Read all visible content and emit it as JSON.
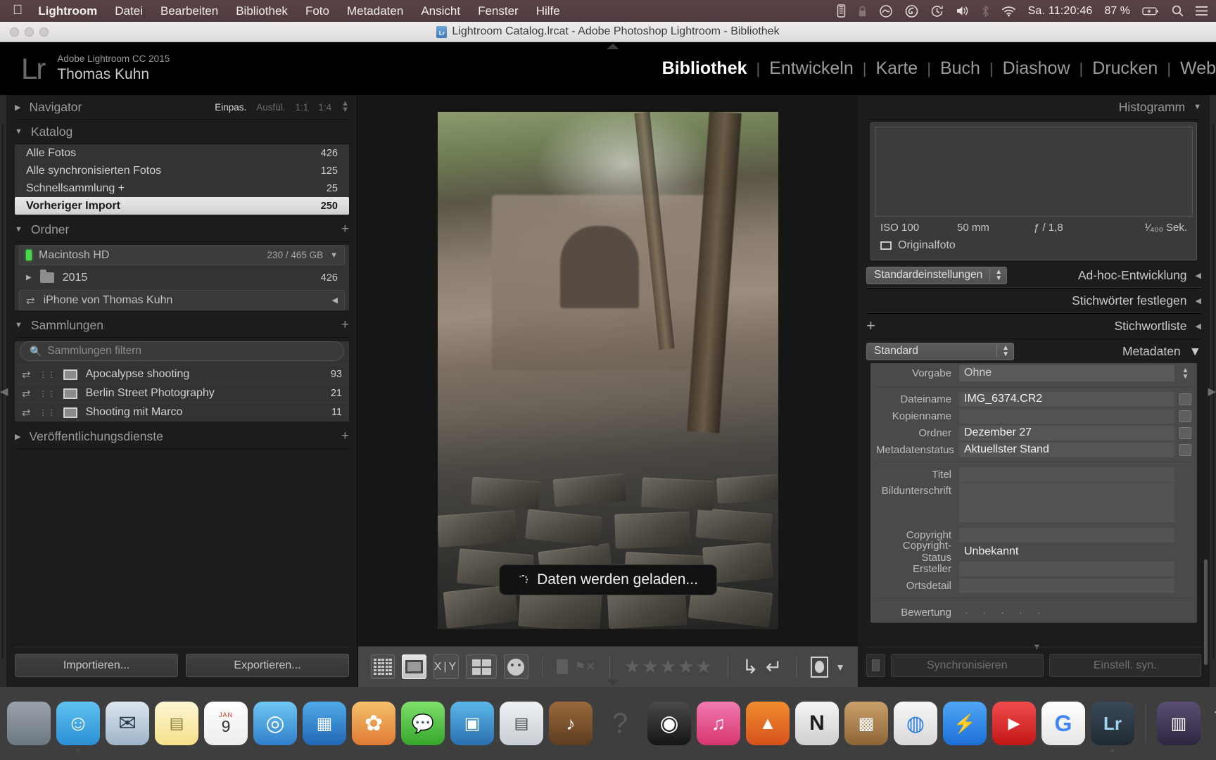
{
  "menubar": {
    "apple": "",
    "app_name": "Lightroom",
    "items": [
      "Datei",
      "Bearbeiten",
      "Bibliothek",
      "Foto",
      "Metadaten",
      "Ansicht",
      "Fenster",
      "Hilfe"
    ],
    "status_icons": [
      "battery-indicator-icon",
      "lock-icon",
      "creative-cloud-icon",
      "adobe-app-icon",
      "time-machine-icon",
      "volume-icon",
      "bluetooth-icon",
      "wifi-icon"
    ],
    "clock": "Sa. 11:20:46",
    "battery": "87 %",
    "right_icons": [
      "spotlight-search-icon",
      "notification-center-icon"
    ]
  },
  "titlebar": {
    "title": "Lightroom Catalog.lrcat - Adobe Photoshop Lightroom - Bibliothek"
  },
  "identity": {
    "logo": "Lr",
    "product": "Adobe Lightroom CC 2015",
    "user": "Thomas Kuhn"
  },
  "modules": [
    {
      "label": "Bibliothek",
      "active": true
    },
    {
      "label": "Entwickeln",
      "active": false
    },
    {
      "label": "Karte",
      "active": false
    },
    {
      "label": "Buch",
      "active": false
    },
    {
      "label": "Diashow",
      "active": false
    },
    {
      "label": "Drucken",
      "active": false
    },
    {
      "label": "Web",
      "active": false
    }
  ],
  "left_panel": {
    "navigator": {
      "title": "Navigator",
      "zoom_levels": [
        "Einpas.",
        "Ausfül.",
        "1:1",
        "1:4"
      ],
      "active_zoom": "Einpas."
    },
    "katalog": {
      "title": "Katalog",
      "items": [
        {
          "label": "Alle Fotos",
          "count": "426",
          "selected": false
        },
        {
          "label": "Alle synchronisierten Fotos",
          "count": "125",
          "selected": false
        },
        {
          "label": "Schnellsammlung  +",
          "count": "25",
          "selected": false
        },
        {
          "label": "Vorheriger Import",
          "count": "250",
          "selected": true
        }
      ]
    },
    "ordner": {
      "title": "Ordner",
      "volume": {
        "name": "Macintosh HD",
        "space": "230 / 465 GB"
      },
      "folders": [
        {
          "label": "2015",
          "count": "426"
        }
      ],
      "device": "iPhone von Thomas Kuhn"
    },
    "sammlungen": {
      "title": "Sammlungen",
      "filter_placeholder": "Sammlungen filtern",
      "items": [
        {
          "label": "Apocalypse shooting",
          "count": "93"
        },
        {
          "label": "Berlin Street Photography",
          "count": "21"
        },
        {
          "label": "Shooting mit Marco",
          "count": "11"
        }
      ]
    },
    "publish": {
      "title": "Veröffentlichungsdienste"
    },
    "buttons": {
      "import": "Importieren...",
      "export": "Exportieren..."
    }
  },
  "center": {
    "loading_text": "Daten werden geladen...",
    "toolbar": {
      "view_icons": [
        "grid-view-icon",
        "loupe-view-icon",
        "compare-view-icon",
        "survey-view-icon",
        "people-view-icon"
      ],
      "flag_icons": [
        "flag-pick-icon",
        "flag-reject-icon"
      ],
      "stars": "★★★★★",
      "rotate_icons": [
        "rotate-left-icon",
        "rotate-right-icon"
      ],
      "crop_icon": "crop-overlay-icon",
      "caret": "toolbar-caret-icon"
    }
  },
  "right_panel": {
    "histogram": {
      "title": "Histogramm",
      "iso": "ISO 100",
      "focal": "50 mm",
      "aperture": "ƒ / 1,8",
      "shutter": "¹⁄₄₀₀ Sek.",
      "original": "Originalfoto"
    },
    "quick_develop": {
      "title": "Ad-hoc-Entwicklung",
      "preset": "Standardeinstellungen"
    },
    "keywording": {
      "title": "Stichwörter festlegen"
    },
    "keyword_list": {
      "title": "Stichwortliste",
      "add": "+"
    },
    "metadata": {
      "title": "Metadaten",
      "preset_select": "Standard",
      "fields": [
        {
          "label": "Vorgabe",
          "value": "Ohne",
          "type": "preset"
        },
        {
          "label": "Dateiname",
          "value": "IMG_6374.CR2",
          "type": "text-icon"
        },
        {
          "label": "Kopienname",
          "value": "",
          "type": "text-icon"
        },
        {
          "label": "Ordner",
          "value": "Dezember 27",
          "type": "text-icon"
        },
        {
          "label": "Metadatenstatus",
          "value": "Aktuellster Stand",
          "type": "text-icon"
        },
        {
          "label": "Titel",
          "value": "",
          "type": "text"
        },
        {
          "label": "Bildunterschrift",
          "value": "",
          "type": "textarea"
        },
        {
          "label": "Copyright",
          "value": "",
          "type": "text"
        },
        {
          "label": "Copyright-Status",
          "value": "Unbekannt",
          "type": "select"
        },
        {
          "label": "Ersteller",
          "value": "",
          "type": "text"
        },
        {
          "label": "Ortsdetail",
          "value": "",
          "type": "text"
        }
      ],
      "rating_label": "Bewertung"
    },
    "buttons": {
      "sync": "Synchronisieren",
      "sync_settings": "Einstell. syn."
    }
  },
  "dock": {
    "icons": [
      {
        "name": "finder-icon",
        "glyph": "☺",
        "bg": "linear-gradient(180deg,#5ec3f0,#2b8fd4)"
      },
      {
        "name": "mail-icon",
        "glyph": "✉",
        "bg": "linear-gradient(180deg,#dce6ef,#9fb4c8)"
      },
      {
        "name": "notes-icon",
        "glyph": "▤",
        "bg": "linear-gradient(180deg,#fdf6d4,#f4e18a)"
      },
      {
        "name": "calendar-icon",
        "glyph": "9",
        "bg": "linear-gradient(180deg,#ffffff,#e8e8e8)"
      },
      {
        "name": "safari-icon",
        "glyph": "◎",
        "bg": "linear-gradient(180deg,#6fc7f2,#2f7fc9)"
      },
      {
        "name": "keynote-icon",
        "glyph": "▦",
        "bg": "linear-gradient(180deg,#4fa9e8,#2268b5)"
      },
      {
        "name": "photos-icon",
        "glyph": "✿",
        "bg": "linear-gradient(180deg,#f4c06a,#e07a34)"
      },
      {
        "name": "messages-icon",
        "glyph": "💬",
        "bg": "linear-gradient(180deg,#7ee06c,#36a62a)"
      },
      {
        "name": "presentation-icon",
        "glyph": "▣",
        "bg": "linear-gradient(180deg,#5bb8e8,#2b6fb0)"
      },
      {
        "name": "news-icon",
        "glyph": "▤",
        "bg": "linear-gradient(180deg,#eef1f4,#c9ced4)"
      },
      {
        "name": "garageband-icon",
        "glyph": "♪",
        "bg": "linear-gradient(180deg,#9a6a3c,#5d3c20)"
      },
      {
        "name": "help-icon",
        "glyph": "?",
        "bg": "transparent"
      },
      {
        "name": "camera-app-icon",
        "glyph": "◉",
        "bg": "linear-gradient(180deg,#4a4a4a,#151515)"
      },
      {
        "name": "itunes-icon",
        "glyph": "♫",
        "bg": "linear-gradient(180deg,#f07ab0,#d8356f)"
      },
      {
        "name": "vlc-icon",
        "glyph": "▲",
        "bg": "linear-gradient(180deg,#f08c2e,#d6521c)"
      },
      {
        "name": "nuke-icon",
        "glyph": "N",
        "bg": "linear-gradient(180deg,#f0f0f0,#c8c8c8)"
      },
      {
        "name": "utilities-folder-icon",
        "glyph": "▩",
        "bg": "linear-gradient(180deg,#c9a06a,#8d6536)"
      },
      {
        "name": "chrome-icon",
        "glyph": "◍",
        "bg": "linear-gradient(180deg,#f2f2f2,#d0d0d0)"
      },
      {
        "name": "messenger-icon",
        "glyph": "⚡",
        "bg": "linear-gradient(180deg,#4fa7f5,#1b6fd8)"
      },
      {
        "name": "youtube-icon",
        "glyph": "▶",
        "bg": "linear-gradient(180deg,#f24b4b,#c11717)"
      },
      {
        "name": "google-icon",
        "glyph": "G",
        "bg": "linear-gradient(180deg,#ffffff,#e6e6e6)"
      },
      {
        "name": "lightroom-dock-icon",
        "glyph": "Lr",
        "bg": "linear-gradient(180deg,#3b4a57,#1f2a33)"
      },
      {
        "name": "downloads-stack-icon",
        "glyph": "▥",
        "bg": "linear-gradient(180deg,#5a4f72,#2d2640)"
      },
      {
        "name": "trash-icon",
        "glyph": "🗑",
        "bg": "transparent"
      }
    ]
  }
}
